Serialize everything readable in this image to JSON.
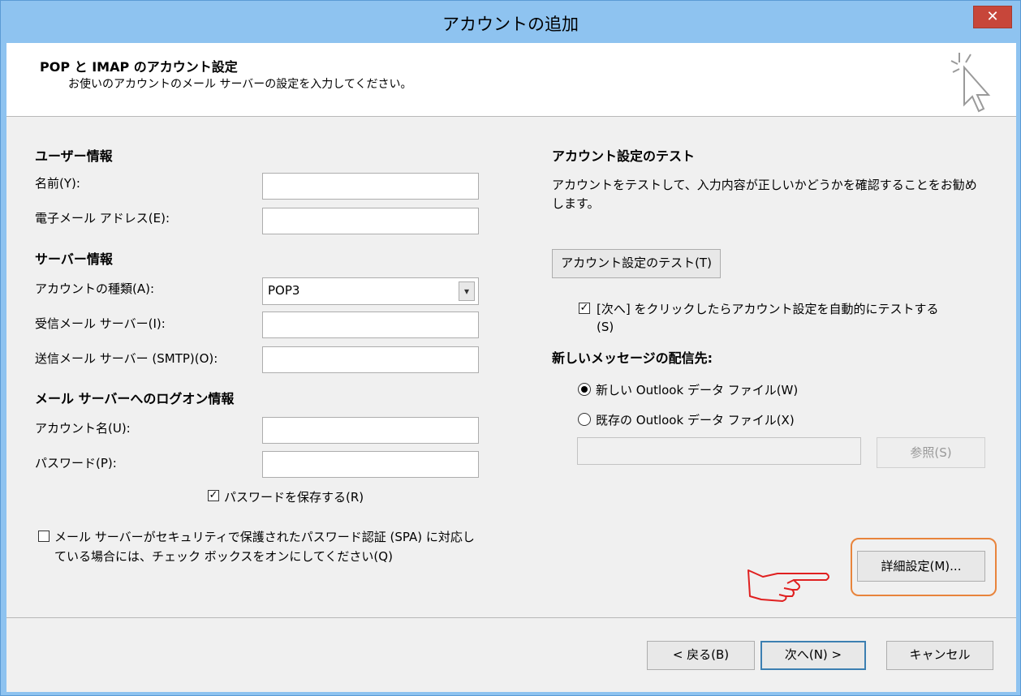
{
  "window": {
    "title": "アカウントの追加",
    "close_label": "✕"
  },
  "header": {
    "title": "POP と IMAP のアカウント設定",
    "subtitle": "お使いのアカウントのメール サーバーの設定を入力してください。"
  },
  "user_info": {
    "section": "ユーザー情報",
    "name_label": "名前(Y):",
    "email_label": "電子メール アドレス(E):",
    "name_value": "",
    "email_value": ""
  },
  "server_info": {
    "section": "サーバー情報",
    "account_type_label": "アカウントの種類(A):",
    "account_type_value": "POP3",
    "incoming_label": "受信メール サーバー(I):",
    "outgoing_label": "送信メール サーバー (SMTP)(O):"
  },
  "logon": {
    "section": "メール サーバーへのログオン情報",
    "account_name_label": "アカウント名(U):",
    "password_label": "パスワード(P):",
    "remember_password": "パスワードを保存する(R)",
    "spa_line1": "メール サーバーがセキュリティで保護されたパスワード認証 (SPA) に対応し",
    "spa_line2": "ている場合には、チェック ボックスをオンにしてください(Q)"
  },
  "test": {
    "section": "アカウント設定のテスト",
    "desc_line1": "アカウントをテストして、入力内容が正しいかどうかを確認することをお勧め",
    "desc_line2": "します。",
    "test_button": "アカウント設定のテスト(T)",
    "auto_test_line1": "[次へ] をクリックしたらアカウント設定を自動的にテストする",
    "auto_test_line2": "(S)"
  },
  "delivery": {
    "section": "新しいメッセージの配信先:",
    "new_file": "新しい Outlook データ ファイル(W)",
    "existing_file": "既存の Outlook データ ファイル(X)",
    "browse_button": "参照(S)"
  },
  "more_settings_button": "詳細設定(M)...",
  "footer": {
    "back": "< 戻る(B)",
    "next": "次へ(N) >",
    "cancel": "キャンセル"
  },
  "colors": {
    "titlebar": "#8ec3f0",
    "close": "#c7463a",
    "highlight": "#e8843c",
    "hand": "#e02020"
  }
}
